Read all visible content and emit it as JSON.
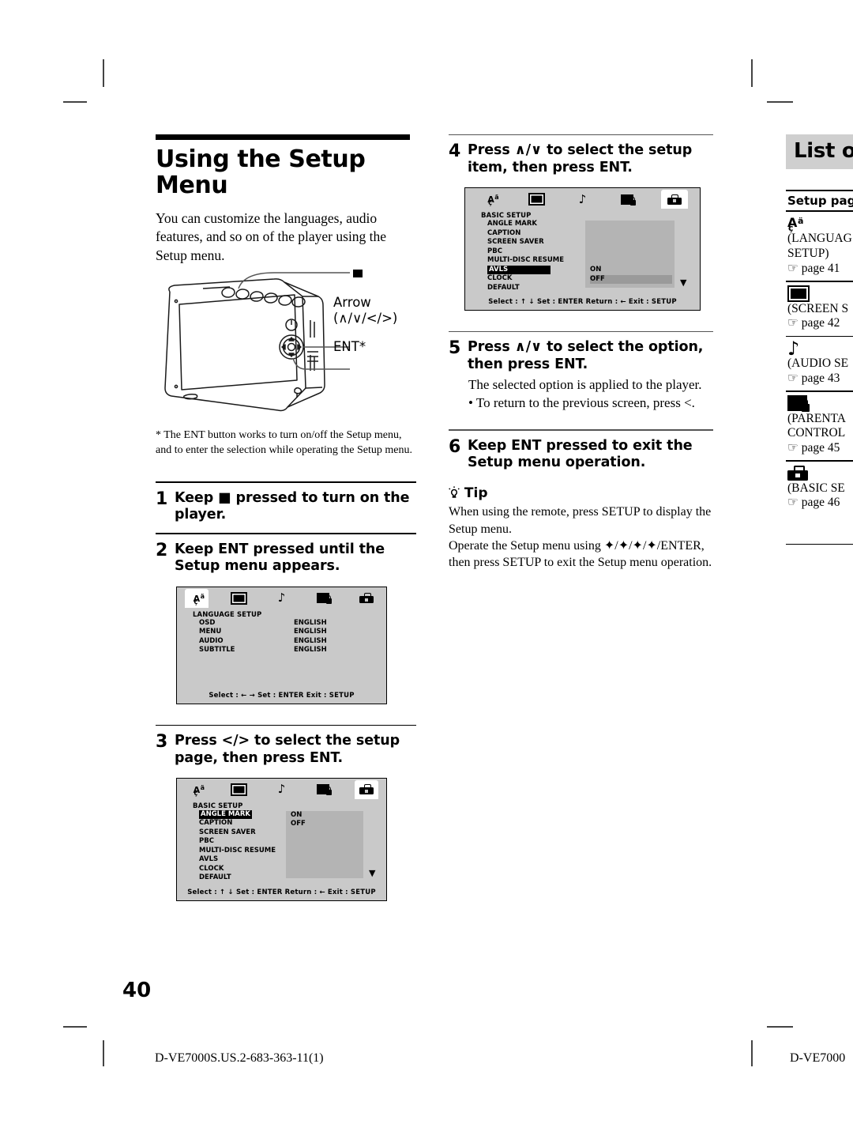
{
  "page": {
    "number": "40",
    "doc_id_left": "D-VE7000S.US.2-683-363-11(1)",
    "doc_id_right": "D-VE7000"
  },
  "column1": {
    "title": "Using the Setup Menu",
    "intro": "You can customize the languages, audio features, and so on of the player using the Setup menu.",
    "callouts": {
      "stop_square": "■",
      "arrow_label": "Arrow",
      "arrow_keys": "(∧/∨/</>)",
      "ent_label": "ENT*"
    },
    "footnote": "* The ENT button works to turn on/off the Setup menu, and to enter the selection while operating the Setup menu.",
    "steps": [
      {
        "num": "1",
        "text": "Keep ■ pressed to turn on the player."
      },
      {
        "num": "2",
        "text": "Keep ENT pressed until the Setup menu appears."
      },
      {
        "num": "3",
        "text": "Press </> to select the setup page, then press ENT."
      }
    ],
    "osd_language": {
      "tabs": [
        "language-icon",
        "screen-icon",
        "audio-icon",
        "parental-icon",
        "basic-icon"
      ],
      "active_tab": 0,
      "heading": "LANGUAGE SETUP",
      "rows": [
        {
          "key": "OSD",
          "value": "ENGLISH"
        },
        {
          "key": "MENU",
          "value": "ENGLISH"
        },
        {
          "key": "AUDIO",
          "value": "ENGLISH"
        },
        {
          "key": "SUBTITLE",
          "value": "ENGLISH"
        }
      ],
      "footer": "Select : ← →   Set : ENTER  Exit : SETUP"
    },
    "osd_basic_step3": {
      "active_tab": 4,
      "heading": "BASIC SETUP",
      "rows": [
        "ANGLE MARK",
        "CAPTION",
        "SCREEN SAVER",
        "PBC",
        "MULTI-DISC RESUME",
        "AVLS",
        "CLOCK",
        "DEFAULT"
      ],
      "selected_row": 0,
      "options": [
        "ON",
        "OFF"
      ],
      "highlighted_option": -1,
      "scroll_arrow": "▼",
      "footer": "Select : ↑ ↓   Set : ENTER  Return : ←  Exit : SETUP"
    }
  },
  "column2": {
    "steps": [
      {
        "num": "4",
        "text": "Press ∧/∨ to select the setup item, then press ENT."
      },
      {
        "num": "5",
        "text": "Press ∧/∨ to select the option, then press ENT."
      },
      {
        "num": "6",
        "text": "Keep ENT pressed to exit the Setup menu operation."
      }
    ],
    "osd_basic_step4": {
      "active_tab": 4,
      "heading": "BASIC SETUP",
      "rows": [
        "ANGLE MARK",
        "CAPTION",
        "SCREEN SAVER",
        "PBC",
        "MULTI-DISC RESUME",
        "AVLS",
        "CLOCK",
        "DEFAULT"
      ],
      "selected_row": 5,
      "options": [
        "ON",
        "OFF"
      ],
      "highlighted_option": 1,
      "scroll_arrow": "▼",
      "footer": "Select : ↑ ↓   Set : ENTER  Return : ←  Exit : SETUP"
    },
    "step5_body": "The selected option is applied to the player.",
    "step5_bullet": "• To return to the previous screen, press <.",
    "tip_label": "Tip",
    "tip_icon": "lightbulb-icon",
    "tip_lines": [
      "When using the remote, press SETUP to display the",
      "Setup menu.",
      "Operate the Setup menu using ✦/✦/✦/✦/ENTER,",
      "then press SETUP to exit the Setup menu operation."
    ]
  },
  "column3": {
    "banner": "List o",
    "table_header": "Setup page",
    "entries": [
      {
        "icon": "language-icon",
        "line1": "(LANGUAG",
        "line2": "SETUP)",
        "page_ref": "☞ page 41"
      },
      {
        "icon": "screen-icon",
        "line1": "(SCREEN S",
        "line2": "",
        "page_ref": "☞ page 42"
      },
      {
        "icon": "audio-icon",
        "line1": "(AUDIO SE",
        "line2": "",
        "page_ref": "☞ page 43"
      },
      {
        "icon": "parental-icon",
        "line1": "(PARENTA",
        "line2": "CONTROL",
        "page_ref": "☞ page 45"
      },
      {
        "icon": "basic-icon",
        "line1": "(BASIC SE",
        "line2": "",
        "page_ref": "☞ page 46"
      }
    ]
  }
}
